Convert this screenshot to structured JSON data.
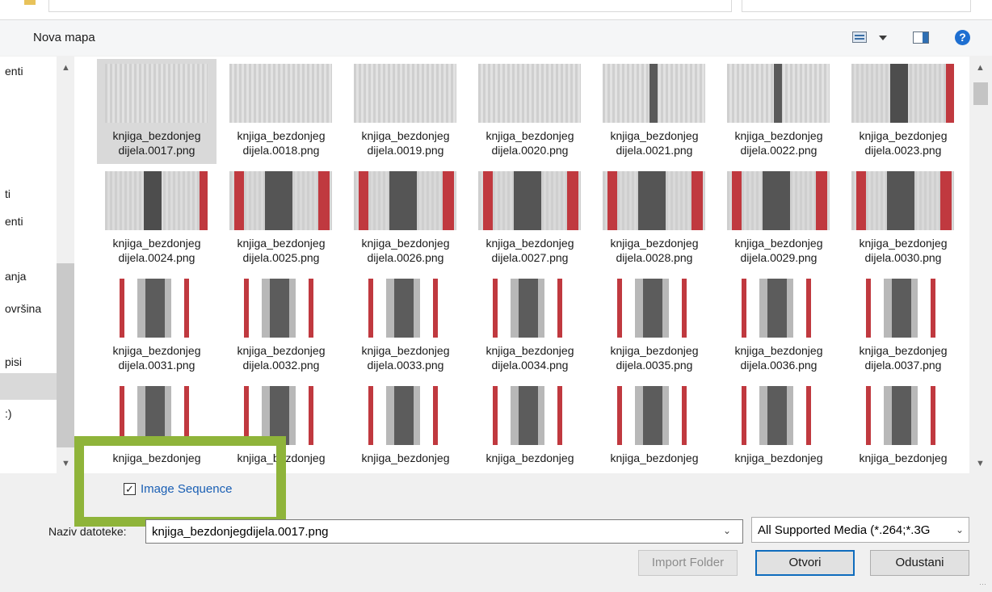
{
  "toolbar": {
    "new_folder_label": "Nova mapa",
    "help_label": "?"
  },
  "nav": {
    "items": [
      "enti",
      "ti",
      "enti",
      "anja",
      "ovršina",
      "pisi",
      ":)"
    ]
  },
  "files": [
    {
      "line1": "knjiga_bezdonjeg",
      "line2": "dijela.0017.png",
      "style": "plain",
      "selected": true
    },
    {
      "line1": "knjiga_bezdonjeg",
      "line2": "dijela.0018.png",
      "style": "plain"
    },
    {
      "line1": "knjiga_bezdonjeg",
      "line2": "dijela.0019.png",
      "style": "plain"
    },
    {
      "line1": "knjiga_bezdonjeg",
      "line2": "dijela.0020.png",
      "style": "plain"
    },
    {
      "line1": "knjiga_bezdonjeg",
      "line2": "dijela.0021.png",
      "style": "plain-dark"
    },
    {
      "line1": "knjiga_bezdonjeg",
      "line2": "dijela.0022.png",
      "style": "plain-dark"
    },
    {
      "line1": "knjiga_bezdonjeg",
      "line2": "dijela.0023.png",
      "style": "dark-red"
    },
    {
      "line1": "knjiga_bezdonjeg",
      "line2": "dijela.0024.png",
      "style": "dark-red"
    },
    {
      "line1": "knjiga_bezdonjeg",
      "line2": "dijela.0025.png",
      "style": "red-both"
    },
    {
      "line1": "knjiga_bezdonjeg",
      "line2": "dijela.0026.png",
      "style": "red-both"
    },
    {
      "line1": "knjiga_bezdonjeg",
      "line2": "dijela.0027.png",
      "style": "red-both"
    },
    {
      "line1": "knjiga_bezdonjeg",
      "line2": "dijela.0028.png",
      "style": "red-both"
    },
    {
      "line1": "knjiga_bezdonjeg",
      "line2": "dijela.0029.png",
      "style": "red-both"
    },
    {
      "line1": "knjiga_bezdonjeg",
      "line2": "dijela.0030.png",
      "style": "red-both"
    },
    {
      "line1": "knjiga_bezdonjeg",
      "line2": "dijela.0031.png",
      "style": "white"
    },
    {
      "line1": "knjiga_bezdonjeg",
      "line2": "dijela.0032.png",
      "style": "white"
    },
    {
      "line1": "knjiga_bezdonjeg",
      "line2": "dijela.0033.png",
      "style": "white"
    },
    {
      "line1": "knjiga_bezdonjeg",
      "line2": "dijela.0034.png",
      "style": "white"
    },
    {
      "line1": "knjiga_bezdonjeg",
      "line2": "dijela.0035.png",
      "style": "white"
    },
    {
      "line1": "knjiga_bezdonjeg",
      "line2": "dijela.0036.png",
      "style": "white"
    },
    {
      "line1": "knjiga_bezdonjeg",
      "line2": "dijela.0037.png",
      "style": "white"
    },
    {
      "line1": "knjiga_bezdonjeg",
      "line2": "",
      "style": "white"
    },
    {
      "line1": "knjiga_bezdonjeg",
      "line2": "",
      "style": "white"
    },
    {
      "line1": "knjiga_bezdonjeg",
      "line2": "",
      "style": "white"
    },
    {
      "line1": "knjiga_bezdonjeg",
      "line2": "",
      "style": "white"
    },
    {
      "line1": "knjiga_bezdonjeg",
      "line2": "",
      "style": "white"
    },
    {
      "line1": "knjiga_bezdonjeg",
      "line2": "",
      "style": "white"
    },
    {
      "line1": "knjiga_bezdonjeg",
      "line2": "",
      "style": "white"
    }
  ],
  "options": {
    "image_sequence_label": "Image Sequence",
    "image_sequence_checked": true
  },
  "footer": {
    "filename_label": "Naziv datoteke:",
    "filename_value": "knjiga_bezdonjegdijela.0017.png",
    "filter_value": "All Supported Media (*.264;*.3G",
    "import_folder_label": "Import Folder",
    "open_label": "Otvori",
    "cancel_label": "Odustani"
  },
  "colors": {
    "accent": "#0f6cbd",
    "highlight_box": "#8fb43a",
    "red_edge": "#c0393f"
  }
}
